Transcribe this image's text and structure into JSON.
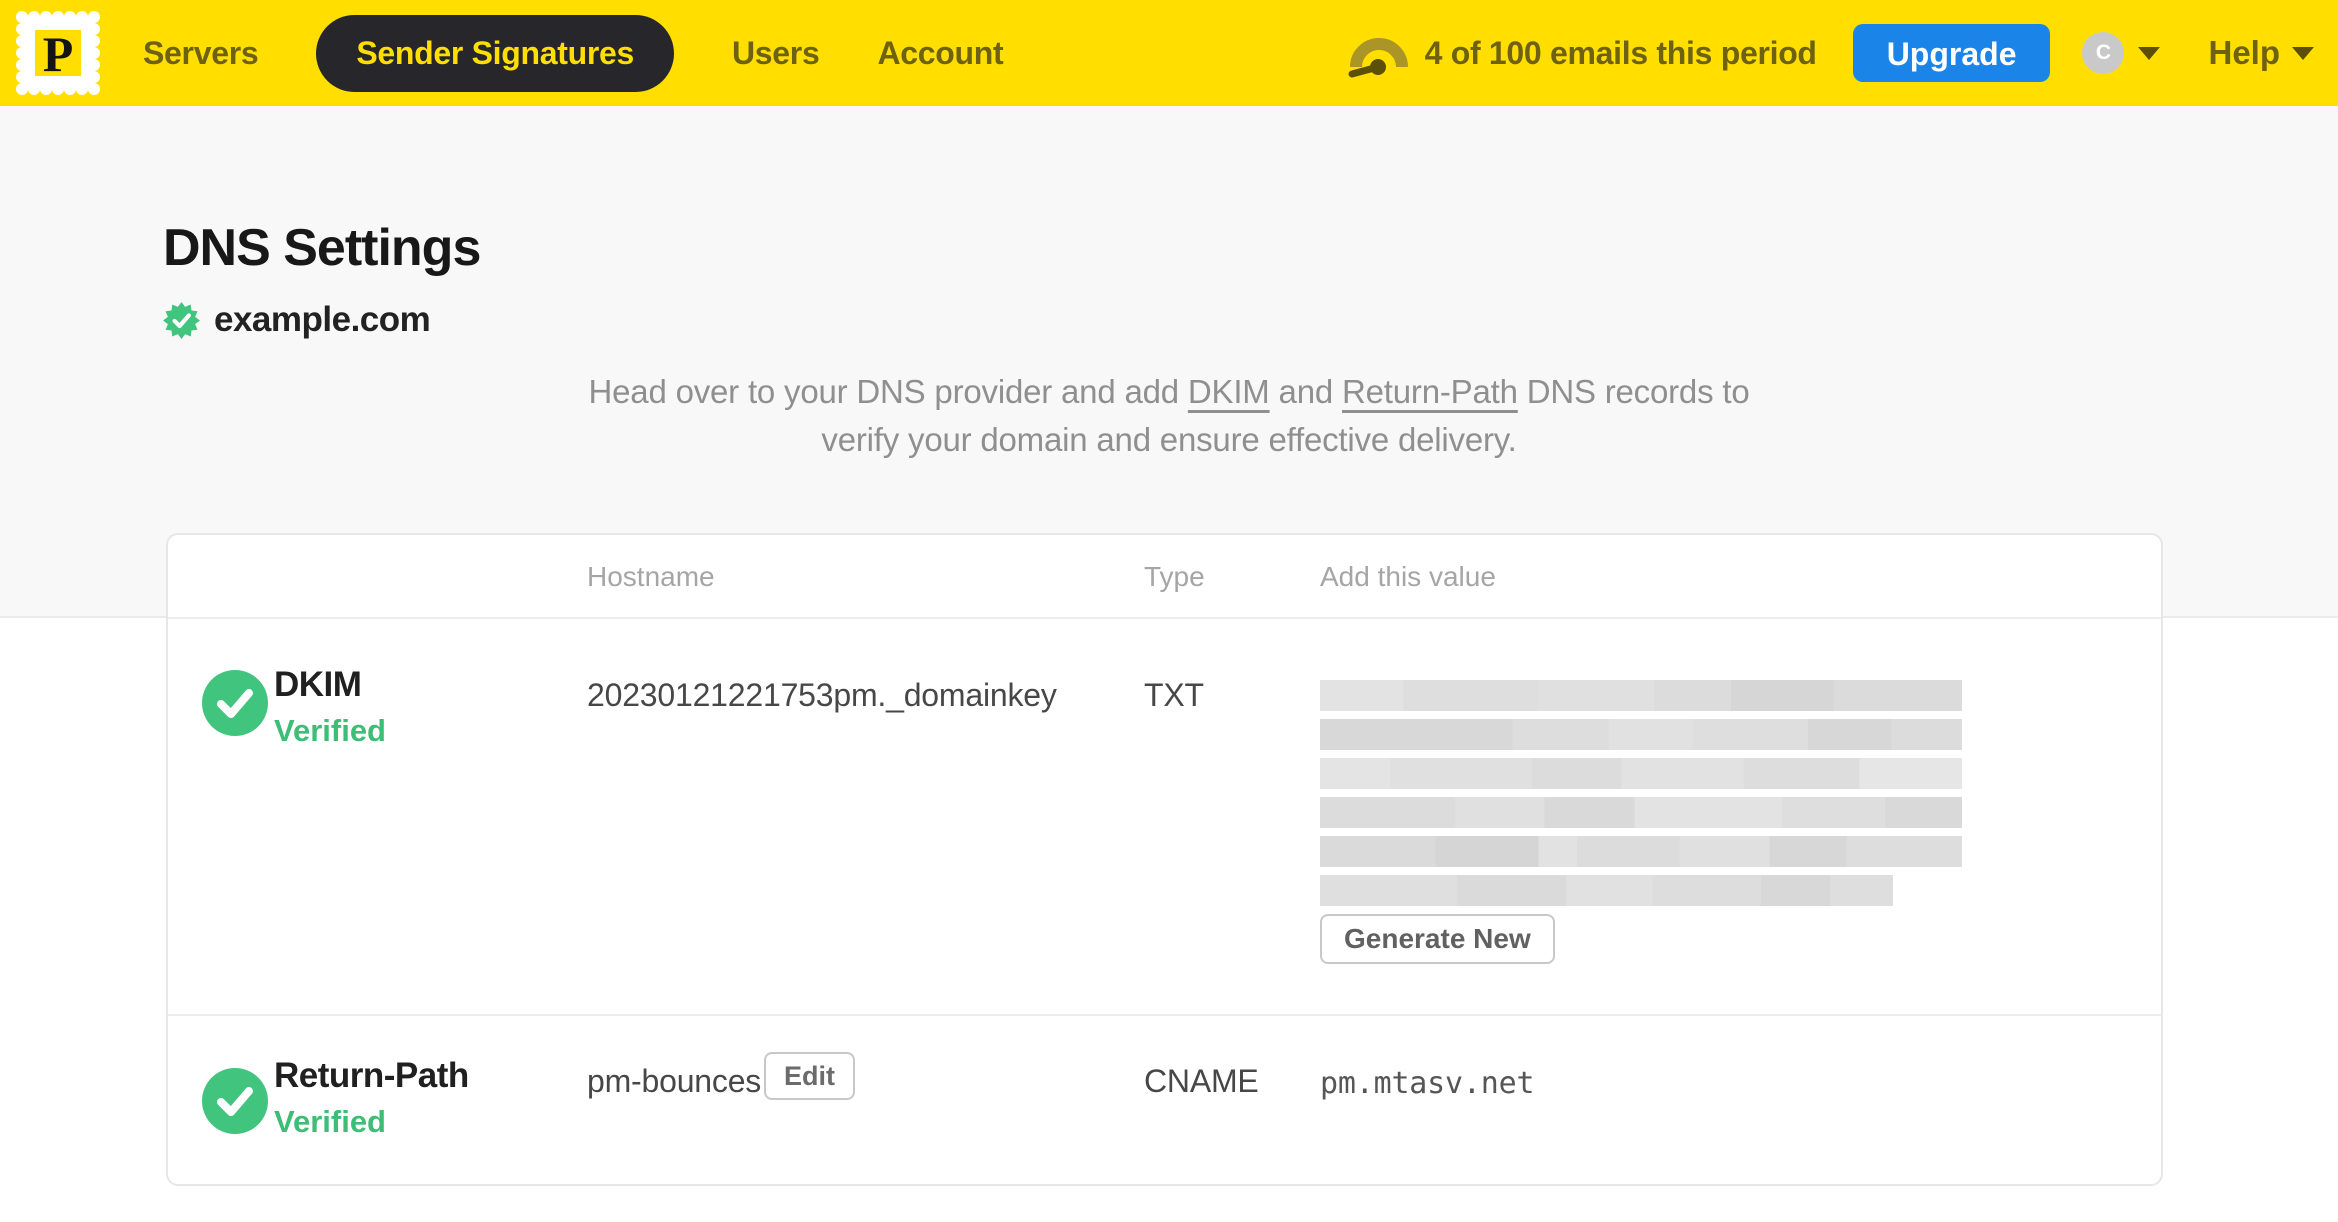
{
  "nav": {
    "brand_letter": "P",
    "items": [
      {
        "label": "Servers",
        "active": false
      },
      {
        "label": "Sender Signatures",
        "active": true
      },
      {
        "label": "Users",
        "active": false
      },
      {
        "label": "Account",
        "active": false
      }
    ],
    "usage_text": "4 of 100 emails this period",
    "upgrade_label": "Upgrade",
    "avatar_initial": "C",
    "help_label": "Help"
  },
  "page": {
    "title": "DNS Settings",
    "domain": "example.com",
    "intro": {
      "line1": {
        "pre": "Head over to your DNS provider and add ",
        "dkim_link": "DKIM",
        "and": " and ",
        "return_path_link": "Return-Path",
        "post": " DNS records to"
      },
      "line2": "verify your domain and ensure effective delivery."
    }
  },
  "table": {
    "headers": {
      "hostname": "Hostname",
      "type": "Type",
      "value": "Add this value"
    },
    "rows": [
      {
        "name": "DKIM",
        "status": "Verified",
        "hostname": "20230121221753pm._domainkey",
        "type": "TXT",
        "value": "(redacted)",
        "action_label": "Generate New"
      },
      {
        "name": "Return-Path",
        "status": "Verified",
        "hostname": "pm-bounces",
        "hostname_action_label": "Edit",
        "type": "CNAME",
        "value": "pm.mtasv.net"
      }
    ]
  },
  "colors": {
    "brand_yellow": "#ffde00",
    "nav_text_olive": "#6e6211",
    "pill_dark": "#27272b",
    "upgrade_blue": "#1a84e8",
    "success_green": "#41c47e",
    "verified_text_green": "#3dbd76"
  }
}
